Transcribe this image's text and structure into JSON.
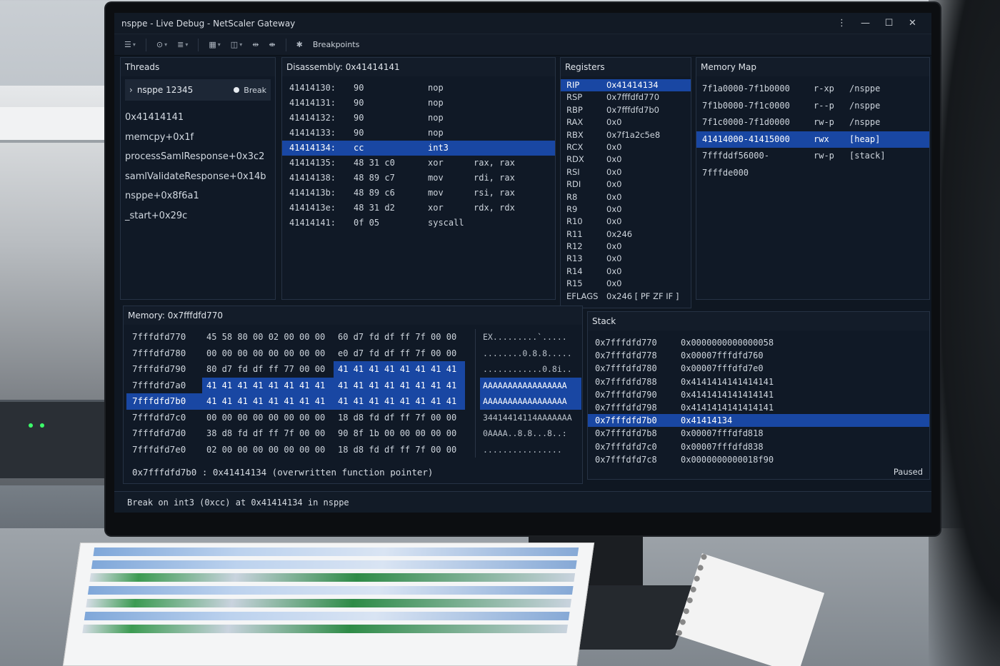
{
  "window": {
    "title": "nsppe - Live Debug - NetScaler Gateway"
  },
  "toolbar": {
    "breakpoints_label": "Breakpoints"
  },
  "threads": {
    "header": "Threads",
    "thread_name": "nsppe 12345",
    "thread_state": "Break",
    "frames": [
      "0x41414141",
      "memcpy+0x1f",
      "processSamlResponse+0x3c2",
      "samlValidateResponse+0x14b",
      "nsppe+0x8f6a1",
      "_start+0x29c"
    ]
  },
  "disassembly": {
    "header": "Disassembly: 0x41414141",
    "rows": [
      {
        "addr": "41414130:",
        "bytes": "90",
        "mnem": "nop",
        "ops": ""
      },
      {
        "addr": "41414131:",
        "bytes": "90",
        "mnem": "nop",
        "ops": ""
      },
      {
        "addr": "41414132:",
        "bytes": "90",
        "mnem": "nop",
        "ops": ""
      },
      {
        "addr": "41414133:",
        "bytes": "90",
        "mnem": "nop",
        "ops": ""
      },
      {
        "addr": "41414134:",
        "bytes": "cc",
        "mnem": "int3",
        "ops": ""
      },
      {
        "addr": "41414135:",
        "bytes": "48 31 c0",
        "mnem": "xor",
        "ops": "rax, rax"
      },
      {
        "addr": "41414138:",
        "bytes": "48 89 c7",
        "mnem": "mov",
        "ops": "rdi, rax"
      },
      {
        "addr": "4141413b:",
        "bytes": "48 89 c6",
        "mnem": "mov",
        "ops": "rsi, rax"
      },
      {
        "addr": "4141413e:",
        "bytes": "48 31 d2",
        "mnem": "xor",
        "ops": "rdx, rdx"
      },
      {
        "addr": "41414141:",
        "bytes": "0f 05",
        "mnem": "syscall",
        "ops": ""
      }
    ]
  },
  "registers": {
    "header": "Registers",
    "rows": [
      {
        "name": "RIP",
        "value": "0x41414134"
      },
      {
        "name": "RSP",
        "value": "0x7fffdfd770"
      },
      {
        "name": "RBP",
        "value": "0x7fffdfd7b0"
      },
      {
        "name": "RAX",
        "value": "0x0"
      },
      {
        "name": "RBX",
        "value": "0x7f1a2c5e8"
      },
      {
        "name": "RCX",
        "value": "0x0"
      },
      {
        "name": "RDX",
        "value": "0x0"
      },
      {
        "name": "RSI",
        "value": "0x0"
      },
      {
        "name": "RDI",
        "value": "0x0"
      },
      {
        "name": "R8",
        "value": "0x0"
      },
      {
        "name": "R9",
        "value": "0x0"
      },
      {
        "name": "R10",
        "value": "0x0"
      },
      {
        "name": "R11",
        "value": "0x246"
      },
      {
        "name": "R12",
        "value": "0x0"
      },
      {
        "name": "R13",
        "value": "0x0"
      },
      {
        "name": "R14",
        "value": "0x0"
      },
      {
        "name": "R15",
        "value": "0x0"
      },
      {
        "name": "EFLAGS",
        "value": "0x246 [ PF ZF IF ]"
      }
    ]
  },
  "memory_map": {
    "header": "Memory Map",
    "rows": [
      {
        "range": "7f1a0000-7f1b0000",
        "perm": "r-xp",
        "name": "/nsppe"
      },
      {
        "range": "7f1b0000-7f1c0000",
        "perm": "r--p",
        "name": "/nsppe"
      },
      {
        "range": "7f1c0000-7f1d0000",
        "perm": "rw-p",
        "name": "/nsppe"
      },
      {
        "range": "41414000-41415000",
        "perm": "rwx",
        "name": "[heap]"
      },
      {
        "range": "7fffddf56000-7fffde000",
        "perm": "rw-p",
        "name": "[stack]"
      }
    ]
  },
  "memory": {
    "header": "Memory: 0x7fffdfd770",
    "rows": [
      {
        "addr": "7fffdfd770",
        "hex1": "45 58 80 00 02 00 00 00",
        "hex2": "60 d7 fd df ff 7f 00 00",
        "ascii": "EX.........`....."
      },
      {
        "addr": "7fffdfd780",
        "hex1": "00 00 00 00 00 00 00 00",
        "hex2": "e0 d7 fd df ff 7f 00 00",
        "ascii": "........0.8.8....."
      },
      {
        "addr": "7fffdfd790",
        "hex1": "80 d7 fd df ff 77 00 00",
        "hex2": "41 41 41 41 41 41 41 41",
        "ascii": "............0.8i.."
      },
      {
        "addr": "7fffdfd7a0",
        "hex1": "41 41 41 41 41 41 41 41",
        "hex2": "41 41 41 41 41 41 41 41",
        "ascii": "AAAAAAAAAAAAAAAAA"
      },
      {
        "addr": "7fffdfd7b0",
        "hex1": "41 41 41 41 41 41 41 41",
        "hex2": "41 41 41 41 41 41 41 41",
        "ascii": "AAAAAAAAAAAAAAAAA"
      },
      {
        "addr": "7fffdfd7c0",
        "hex1": "00 00 00 00 00 00 00 00",
        "hex2": "18 d8 fd df ff 7f 00 00",
        "ascii": "34414414114AAAAAAA"
      },
      {
        "addr": "7fffdfd7d0",
        "hex1": "38 d8 fd df ff 7f 00 00",
        "hex2": "90 8f 1b 00 00 00 00 00",
        "ascii": "0AAAA..8.8...8..:"
      },
      {
        "addr": "7fffdfd7e0",
        "hex1": "02 00 00 00 00 00 00 00",
        "hex2": "18 d8 fd df ff 7f 00 00",
        "ascii": "................"
      }
    ],
    "note": "0x7fffdfd7b0 : 0x41414134 (overwritten function pointer)"
  },
  "stack": {
    "header": "Stack",
    "rows": [
      {
        "addr": "0x7fffdfd770",
        "value": "0x0000000000000058"
      },
      {
        "addr": "0x7fffdfd778",
        "value": "0x00007fffdfd760"
      },
      {
        "addr": "0x7fffdfd780",
        "value": "0x00007fffdfd7e0"
      },
      {
        "addr": "0x7fffdfd788",
        "value": "0x4141414141414141"
      },
      {
        "addr": "0x7fffdfd790",
        "value": "0x4141414141414141"
      },
      {
        "addr": "0x7fffdfd798",
        "value": "0x4141414141414141"
      },
      {
        "addr": "0x7fffdfd7b0",
        "value": "0x41414134"
      },
      {
        "addr": "0x7fffdfd7b8",
        "value": "0x00007fffdfd818"
      },
      {
        "addr": "0x7fffdfd7c0",
        "value": "0x00007fffdfd838"
      },
      {
        "addr": "0x7fffdfd7c8",
        "value": "0x0000000000018f90"
      }
    ],
    "status": "Paused"
  },
  "statusbar": {
    "text": "Break on int3 (0xcc) at 0x41414134 in nsppe"
  },
  "colors": {
    "accent": "#1947a3",
    "panel": "#101926",
    "text": "#cfd6de"
  }
}
